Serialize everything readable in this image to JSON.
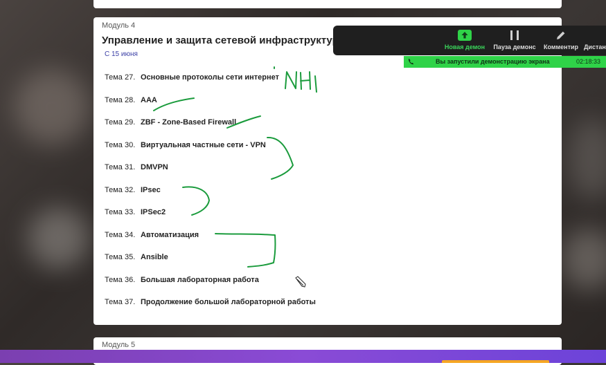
{
  "module4": {
    "label": "Модуль 4",
    "title": "Управление и защита сетевой инфраструктуры",
    "date": "С 15 июня",
    "topics": [
      {
        "num": "Тема 27.",
        "name": "Основные протоколы сети интернет"
      },
      {
        "num": "Тема 28.",
        "name": "AAA"
      },
      {
        "num": "Тема 29.",
        "name": "ZBF - Zone-Based Firewall"
      },
      {
        "num": "Тема 30.",
        "name": "Виртуальная частные сети - VPN"
      },
      {
        "num": "Тема 31.",
        "name": "DMVPN"
      },
      {
        "num": "Тема 32.",
        "name": "IPsec"
      },
      {
        "num": "Тема 33.",
        "name": "IPSec2"
      },
      {
        "num": "Тема 34.",
        "name": "Автоматизация"
      },
      {
        "num": "Тема 35.",
        "name": "Ansible"
      },
      {
        "num": "Тема 36.",
        "name": "Большая лабораторная работа"
      },
      {
        "num": "Тема 37.",
        "name": "Продолжение большой лабораторной работы"
      }
    ]
  },
  "module5": {
    "label": "Модуль 5"
  },
  "toolbar": {
    "new_share": "Новая демон",
    "pause_share": "Пауза демонс",
    "comment": "Комментир",
    "remote": "Дистан"
  },
  "share_banner": {
    "text": "Вы запустили демонстрацию экрана",
    "time": "02:18:33"
  },
  "colors": {
    "accent_green": "#2fd348",
    "ink_green": "#1a9b3c",
    "bottom_bar": "#8a4bd6"
  }
}
